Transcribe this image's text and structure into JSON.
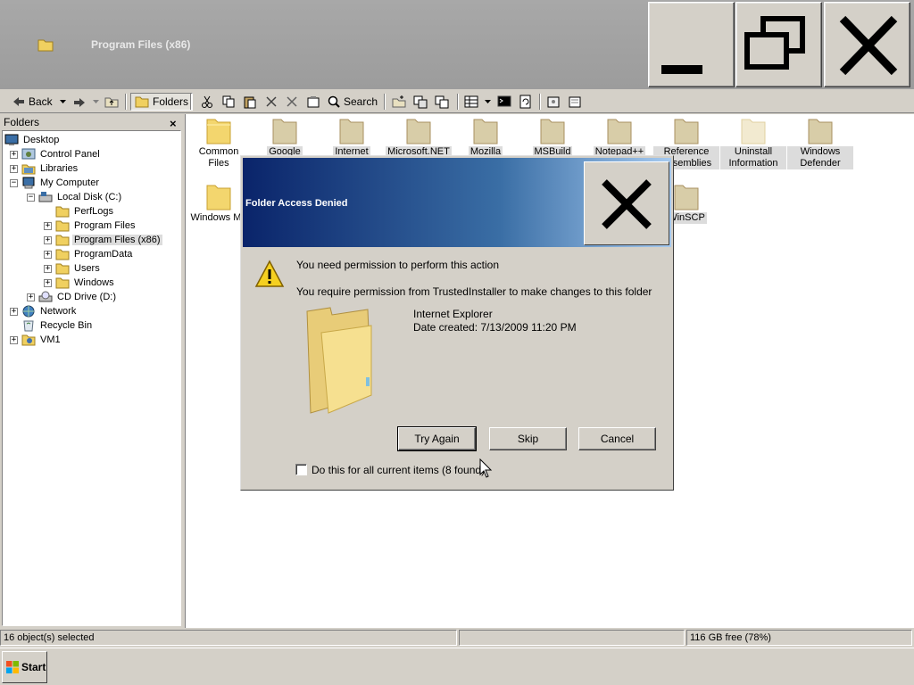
{
  "window": {
    "title": "Program Files (x86)",
    "folder_icon": "folder-icon",
    "min_icon": "minimize-icon",
    "max_icon": "restore-icon",
    "close_icon": "close-icon"
  },
  "toolbar": {
    "back_label": "Back",
    "folders_label": "Folders",
    "search_label": "Search"
  },
  "folders_pane": {
    "header": "Folders",
    "close_glyph": "×",
    "tree": [
      {
        "label": "Desktop",
        "icon": "desktop-icon"
      },
      {
        "label": "Control Panel",
        "icon": "control-panel-icon"
      },
      {
        "label": "Libraries",
        "icon": "libraries-icon"
      },
      {
        "label": "My Computer",
        "icon": "computer-icon"
      },
      {
        "label": "Local Disk (C:)",
        "icon": "drive-icon"
      },
      {
        "label": "PerfLogs",
        "icon": "folder-icon"
      },
      {
        "label": "Program Files",
        "icon": "folder-icon"
      },
      {
        "label": "Program Files (x86)",
        "icon": "folder-icon"
      },
      {
        "label": "ProgramData",
        "icon": "folder-icon"
      },
      {
        "label": "Users",
        "icon": "folder-icon"
      },
      {
        "label": "Windows",
        "icon": "folder-icon"
      },
      {
        "label": "CD Drive (D:)",
        "icon": "cd-drive-icon"
      },
      {
        "label": "Network",
        "icon": "network-icon"
      },
      {
        "label": "Recycle Bin",
        "icon": "recycle-bin-icon"
      },
      {
        "label": "VM1",
        "icon": "user-icon"
      }
    ]
  },
  "content": {
    "folders": [
      {
        "label": "Common Files"
      },
      {
        "label": "Google"
      },
      {
        "label": "Internet"
      },
      {
        "label": "Microsoft.NET"
      },
      {
        "label": "Mozilla"
      },
      {
        "label": "MSBuild"
      },
      {
        "label": "Notepad++"
      },
      {
        "label": "Reference Assemblies"
      },
      {
        "label": "Uninstall Information"
      },
      {
        "label": "Windows Defender"
      },
      {
        "label": "Windows Ma"
      },
      {
        "label": "WinSCP"
      }
    ]
  },
  "dialog": {
    "title": "Folder Access Denied",
    "close_icon": "close-icon",
    "message": "You need permission to perform this action",
    "detail": "You require permission from TrustedInstaller to make changes to this folder",
    "item_name": "Internet Explorer",
    "item_date": "Date created: 7/13/2009 11:20 PM",
    "try_again": "Try Again",
    "skip": "Skip",
    "cancel": "Cancel",
    "checkbox_label": "Do this for all current items (8 found)",
    "warning_icon": "warning-icon"
  },
  "statusbar": {
    "selection": "16 object(s) selected",
    "free_space": "116 GB free (78%)"
  },
  "taskbar": {
    "start_label": "Start"
  },
  "colors": {
    "dialog_title_start": "#0a246a",
    "dialog_title_end": "#a6caf0",
    "chrome": "#d4d0c8"
  }
}
